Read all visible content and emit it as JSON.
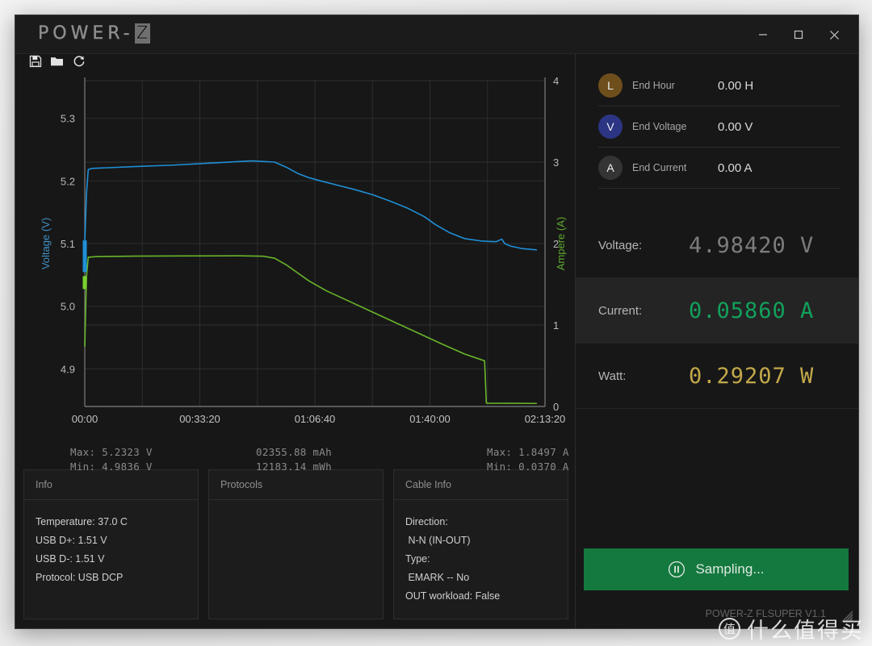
{
  "window": {
    "title": "POWER-Z",
    "logo_main": "POWER-",
    "logo_accent": "Z",
    "minimize_icon": "minimize-icon",
    "maximize_icon": "maximize-icon",
    "close_icon": "close-icon"
  },
  "toolbar": {
    "items": [
      {
        "name": "save-icon",
        "title": "Save"
      },
      {
        "name": "open-folder-icon",
        "title": "Open"
      },
      {
        "name": "refresh-icon",
        "title": "Refresh"
      }
    ]
  },
  "chart_data": {
    "type": "line",
    "title": "",
    "xlabel": "",
    "ylabel": "Voltage (V)",
    "y2label": "Ampere (A)",
    "grid": true,
    "legend": "none",
    "xlim": [
      0,
      8000
    ],
    "xtick_labels": [
      "00:00",
      "00:33:20",
      "01:06:40",
      "01:40:00",
      "02:13:20"
    ],
    "xtick_values": [
      0,
      2000,
      4000,
      6000,
      8000
    ],
    "ylim": [
      4.84,
      5.36
    ],
    "ytick_labels": [
      "4.9",
      "5.0",
      "5.1",
      "5.2",
      "5.3"
    ],
    "ytick_values": [
      4.9,
      5.0,
      5.1,
      5.2,
      5.3
    ],
    "y2lim": [
      0,
      4
    ],
    "y2tick_labels": [
      "0",
      "1",
      "2",
      "3",
      "4"
    ],
    "y2tick_values": [
      0,
      1,
      2,
      3,
      4
    ],
    "series": [
      {
        "name": "Voltage",
        "axis": "left",
        "color": "#1f8fd6",
        "unit": "V",
        "x": [
          0,
          30,
          60,
          120,
          400,
          900,
          1500,
          2300,
          2900,
          3300,
          3500,
          3700,
          3900,
          4100,
          4400,
          4700,
          5000,
          5300,
          5600,
          5900,
          6100,
          6350,
          6600,
          6900,
          7150,
          7250,
          7300,
          7400,
          7600,
          7850
        ],
        "y": [
          5.102,
          5.18,
          5.218,
          5.22,
          5.221,
          5.223,
          5.225,
          5.229,
          5.232,
          5.23,
          5.222,
          5.212,
          5.205,
          5.2,
          5.193,
          5.186,
          5.178,
          5.168,
          5.157,
          5.143,
          5.13,
          5.117,
          5.108,
          5.104,
          5.103,
          5.107,
          5.1,
          5.096,
          5.092,
          5.09
        ]
      },
      {
        "name": "Current",
        "axis": "right",
        "color": "#69b52a",
        "unit": "A",
        "x": [
          0,
          30,
          60,
          200,
          900,
          1800,
          2700,
          3100,
          3300,
          3500,
          3700,
          3900,
          4200,
          4600,
          5000,
          5400,
          5800,
          6200,
          6600,
          6950,
          6980,
          7000,
          7400,
          7850
        ],
        "y": [
          0.74,
          1.6,
          1.832,
          1.84,
          1.846,
          1.848,
          1.8497,
          1.845,
          1.82,
          1.74,
          1.64,
          1.54,
          1.42,
          1.29,
          1.16,
          1.03,
          0.9,
          0.77,
          0.645,
          0.56,
          0.042,
          0.04,
          0.039,
          0.037
        ]
      }
    ],
    "stats": {
      "voltage_max": "Max: 5.2323 V",
      "voltage_min": "Min: 4.9836 V",
      "capacity_mah": "02355.88 mAh",
      "energy_mwh": "12183.14 mWh",
      "current_max": "Max: 1.8497 A",
      "current_min": "Min: 0.0370 A"
    }
  },
  "info_cards": [
    {
      "title": "Info",
      "lines": [
        "Temperature: 37.0 C",
        "USB D+: 1.51 V",
        "USB D-: 1.51 V",
        "Protocol: USB DCP"
      ]
    },
    {
      "title": "Protocols",
      "lines": []
    },
    {
      "title": "Cable Info",
      "lines": [
        "Direction:",
        " N-N (IN-OUT)",
        "Type:",
        " EMARK -- No",
        "OUT workload: False"
      ]
    }
  ],
  "end_conditions": [
    {
      "badge": "L",
      "badge_color": "#6e4f1c",
      "label": "End Hour",
      "value": "0.00 H"
    },
    {
      "badge": "V",
      "badge_color": "#2b3583",
      "label": "End Voltage",
      "value": "0.00 V"
    },
    {
      "badge": "A",
      "badge_color": "#343434",
      "label": "End Current",
      "value": "0.00 A"
    }
  ],
  "readouts": [
    {
      "label": "Voltage:",
      "value": "4.98420 V",
      "color": "#7d7d7d",
      "highlight": false
    },
    {
      "label": "Current:",
      "value": "0.05860 A",
      "color": "#12a05c",
      "highlight": true
    },
    {
      "label": "Watt:",
      "value": "0.29207 W",
      "color": "#c2a84a",
      "highlight": false
    }
  ],
  "sampling_button": {
    "label": "Sampling...",
    "icon": "pause-circle-icon",
    "color": "#14793f"
  },
  "footer": {
    "device": "POWER-Z FLSUPER V1.1"
  },
  "watermark": {
    "badge": "值",
    "text": "什么值得买"
  }
}
